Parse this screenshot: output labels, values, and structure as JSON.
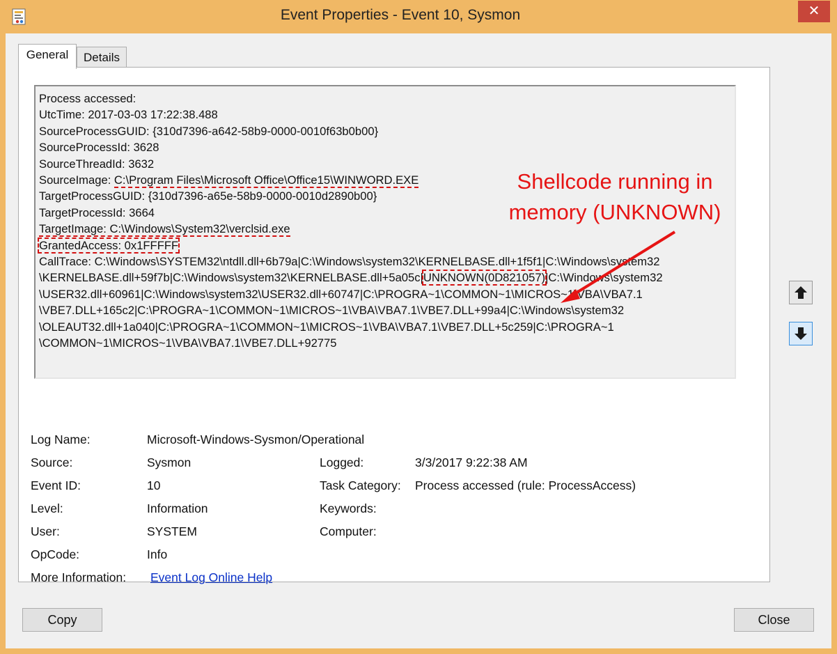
{
  "window": {
    "title": "Event Properties - Event 10, Sysmon",
    "close_glyph": "✕"
  },
  "tabs": [
    {
      "label": "General",
      "active": true
    },
    {
      "label": "Details",
      "active": false
    }
  ],
  "description": {
    "lines": {
      "l1": "Process accessed:",
      "l2": "UtcTime: 2017-03-03 17:22:38.488",
      "l3": "SourceProcessGUID: {310d7396-a642-58b9-0000-0010f63b0b00}",
      "l4": "SourceProcessId: 3628",
      "l5": "SourceThreadId: 3632",
      "l6_label": "SourceImage: ",
      "l6_value": "C:\\Program Files\\Microsoft Office\\Office15\\WINWORD.EXE",
      "l7": "TargetProcessGUID: {310d7396-a65e-58b9-0000-0010d2890b00}",
      "l8": "TargetProcessId: 3664",
      "l9": "TargetImage: C:\\Windows\\System32\\verclsid.exe",
      "l10": "GrantedAccess: 0x1FFFFF",
      "l11": "CallTrace: C:\\Windows\\SYSTEM32\\ntdll.dll+6b79a|C:\\Windows\\system32\\KERNELBASE.dll+1f5f1|C:\\Windows\\system32",
      "l12_pre": "\\KERNELBASE.dll+59f7b|C:\\Windows\\system32\\KERNELBASE.dll+5a05c|",
      "l12_unknown": "UNKNOWN(0D821057)",
      "l12_post": "|C:\\Windows\\system32",
      "l13": "\\USER32.dll+60961|C:\\Windows\\system32\\USER32.dll+60747|C:\\PROGRA~1\\COMMON~1\\MICROS~1\\VBA\\VBA7.1",
      "l14": "\\VBE7.DLL+165c2|C:\\PROGRA~1\\COMMON~1\\MICROS~1\\VBA\\VBA7.1\\VBE7.DLL+99a4|C:\\Windows\\system32",
      "l15": "\\OLEAUT32.dll+1a040|C:\\PROGRA~1\\COMMON~1\\MICROS~1\\VBA\\VBA7.1\\VBE7.DLL+5c259|C:\\PROGRA~1",
      "l16": "\\COMMON~1\\MICROS~1\\VBA\\VBA7.1\\VBE7.DLL+92775"
    }
  },
  "annotation": {
    "line1": "Shellcode running in",
    "line2": "memory (UNKNOWN)",
    "color": "#e61414"
  },
  "details": {
    "log_name_label": "Log Name:",
    "log_name_value": "Microsoft-Windows-Sysmon/Operational",
    "source_label": "Source:",
    "source_value": "Sysmon",
    "logged_label": "Logged:",
    "logged_value": "3/3/2017 9:22:38 AM",
    "event_id_label": "Event ID:",
    "event_id_value": "10",
    "task_category_label": "Task Category:",
    "task_category_value": "Process accessed (rule: ProcessAccess)",
    "level_label": "Level:",
    "level_value": "Information",
    "keywords_label": "Keywords:",
    "user_label": "User:",
    "user_value": "SYSTEM",
    "computer_label": "Computer:",
    "opcode_label": "OpCode:",
    "opcode_value": "Info",
    "more_info_label": "More Information:",
    "more_info_link": "Event Log Online Help"
  },
  "buttons": {
    "copy": "Copy",
    "close": "Close"
  },
  "icons": {
    "app": "event-viewer-icon",
    "up": "arrow-up-icon",
    "down": "arrow-down-icon"
  }
}
